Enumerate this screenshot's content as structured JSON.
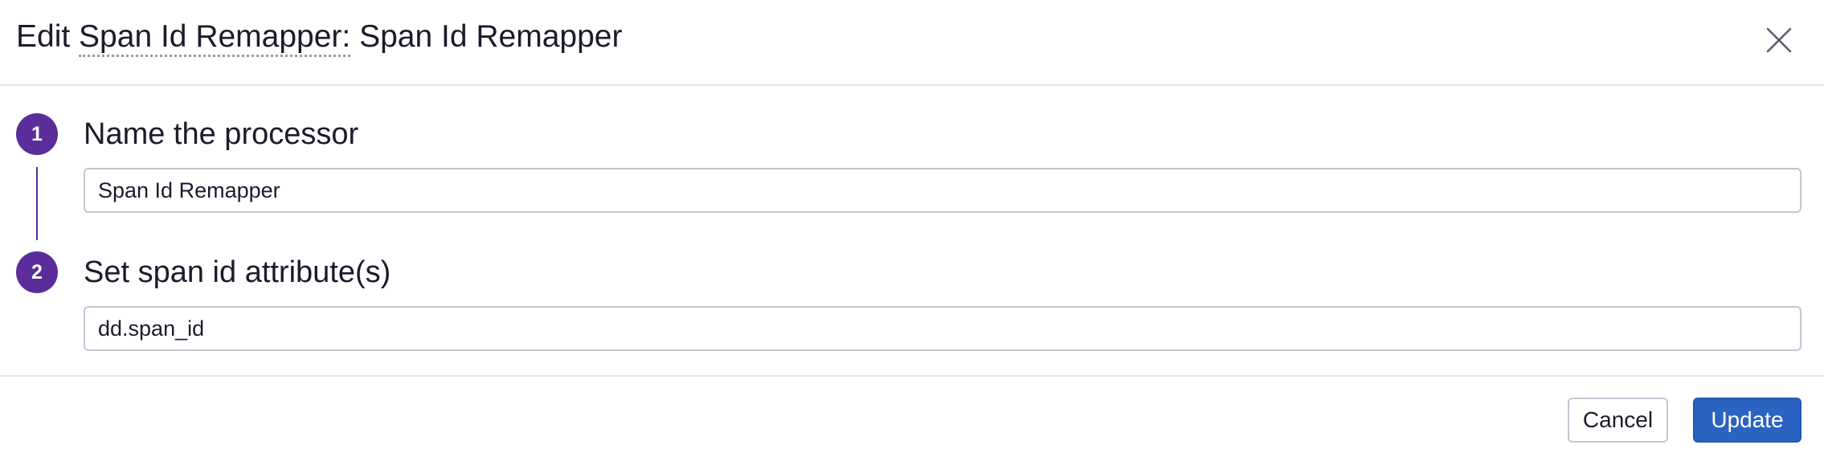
{
  "modal": {
    "title_prefix": "Edit ",
    "title_type": "Span Id Remapper:",
    "title_name": " Span Id Remapper"
  },
  "steps": [
    {
      "number": "1",
      "title": "Name the processor",
      "input_value": "Span Id Remapper"
    },
    {
      "number": "2",
      "title": "Set span id attribute(s)",
      "input_value": "dd.span_id"
    }
  ],
  "footer": {
    "cancel_label": "Cancel",
    "update_label": "Update"
  },
  "colors": {
    "step_accent": "#5a2d9a",
    "primary_button": "#2a63c1"
  },
  "icons": {
    "close": "close-icon"
  }
}
